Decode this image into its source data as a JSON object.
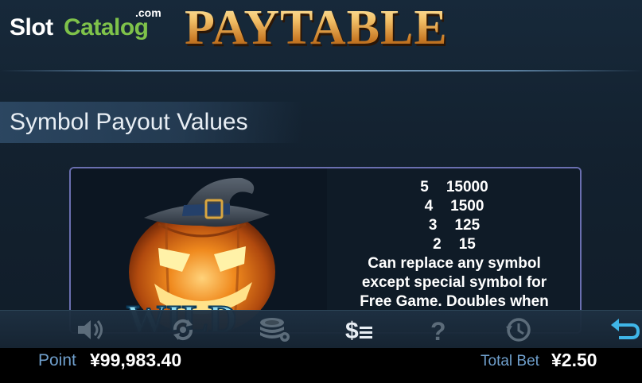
{
  "logo": {
    "part1": "Slot",
    "part2": "Catalog",
    "suffix": ".com"
  },
  "header": {
    "title": "PAYTABLE"
  },
  "section": {
    "title": "Symbol Payout Values"
  },
  "symbol": {
    "name": "wild-pumpkin",
    "label": "WILD",
    "payouts": [
      {
        "count": "5",
        "value": "15000"
      },
      {
        "count": "4",
        "value": "1500"
      },
      {
        "count": "3",
        "value": "125"
      },
      {
        "count": "2",
        "value": "15"
      }
    ],
    "description": [
      "Can replace any symbol",
      "except special symbol for",
      "Free Game. Doubles when"
    ]
  },
  "toolbar": {
    "icons": [
      "sound-icon",
      "autospin-icon",
      "chips-settings-icon",
      "paytable-icon",
      "help-icon",
      "history-icon",
      "back-icon"
    ],
    "paytable_dollar": "$"
  },
  "status": {
    "point_label": "Point",
    "point_value": "¥99,983.40",
    "bet_label": "Total Bet",
    "bet_value": "¥2.50"
  },
  "colors": {
    "accent_blue": "#6f9fcc",
    "gold": "#e4a24a",
    "logo_green": "#7ec24a",
    "back_arrow": "#3fb6e8"
  }
}
